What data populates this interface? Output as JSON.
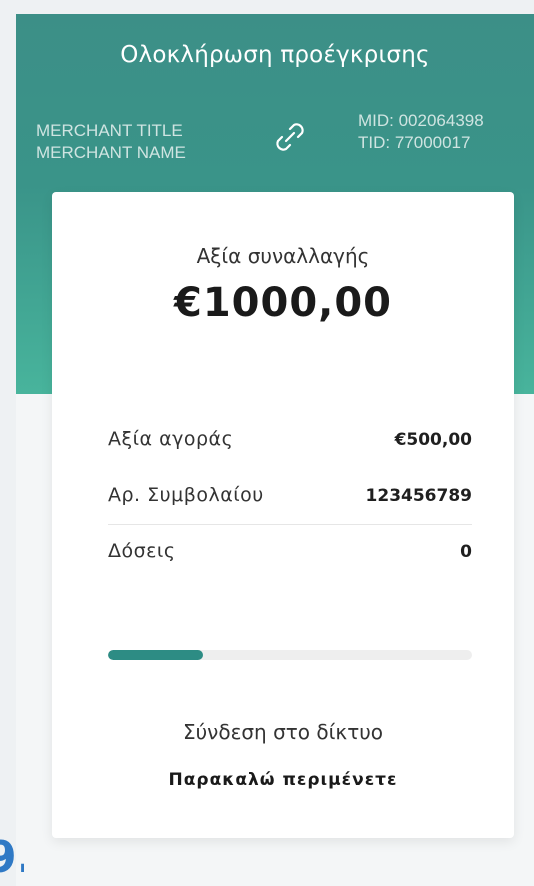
{
  "header": {
    "title": "Ολοκλήρωση προέγκρισης",
    "merchant_title": "MERCHANT TITLE",
    "merchant_name": "MERCHANT NAME",
    "mid": "MID: 002064398",
    "tid": "TID: 77000017",
    "link_icon": "link-icon"
  },
  "transaction": {
    "amount_label": "Αξία συναλλαγής",
    "amount_value": "€1000,00"
  },
  "details": [
    {
      "label": "Αξία αγοράς",
      "value": "€500,00"
    },
    {
      "label": "Αρ. Συμβολαίου",
      "value": "123456789"
    },
    {
      "label": "Δόσεις",
      "value": "0"
    }
  ],
  "progress": {
    "fraction": 0.26,
    "color": "#2d8c84"
  },
  "status": {
    "message": "Σύνδεση στο δίκτυο",
    "wait": "Παρακαλώ περιμένετε"
  },
  "colors": {
    "header_top": "#3c8f87",
    "header_bottom": "#48b49c",
    "accent": "#2d8c84"
  },
  "corner": {
    "glyph": "9."
  }
}
